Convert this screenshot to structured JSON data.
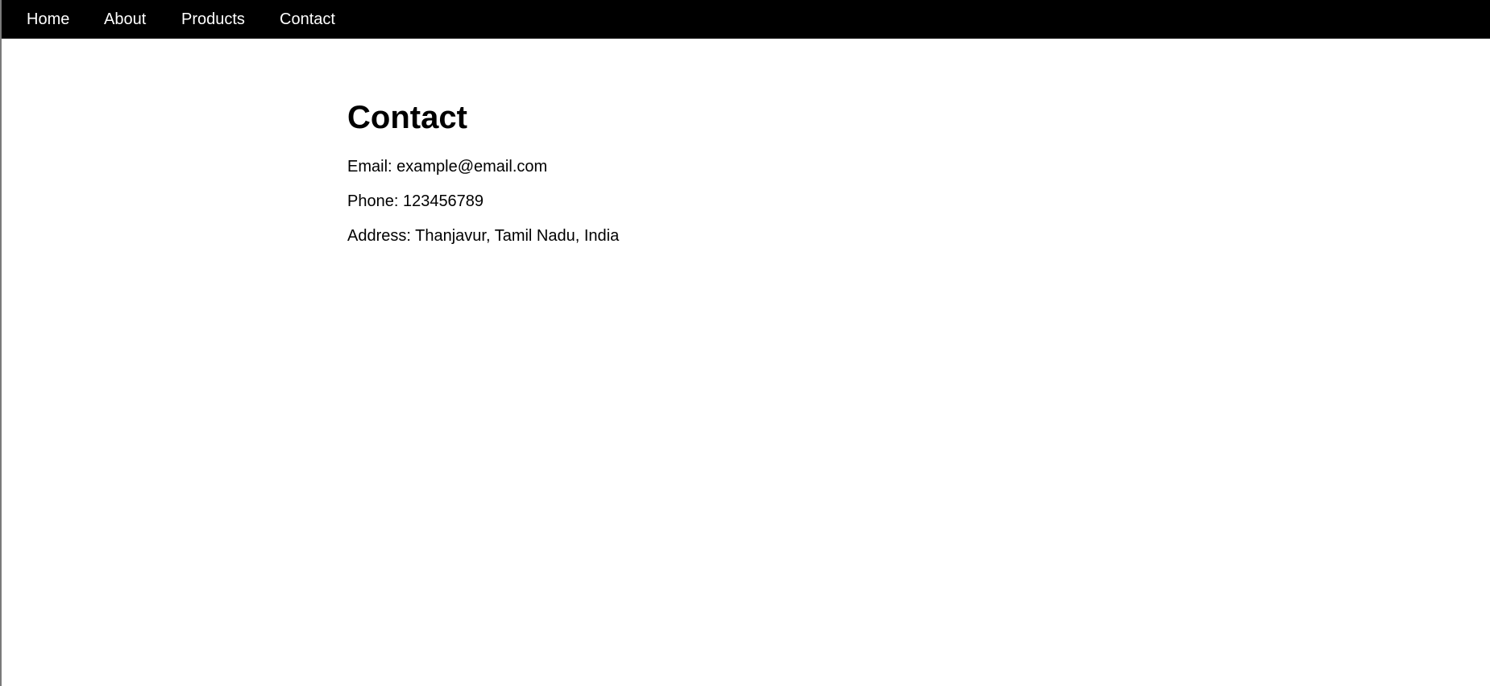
{
  "nav": {
    "items": [
      {
        "label": "Home"
      },
      {
        "label": "About"
      },
      {
        "label": "Products"
      },
      {
        "label": "Contact"
      }
    ]
  },
  "main": {
    "title": "Contact",
    "email": "Email: example@email.com",
    "phone": "Phone: 123456789",
    "address": "Address: Thanjavur, Tamil Nadu, India"
  },
  "colors": {
    "navbar_bg": "#000000",
    "nav_text": "#ffffff",
    "page_bg": "#ffffff",
    "body_text": "#000000"
  }
}
